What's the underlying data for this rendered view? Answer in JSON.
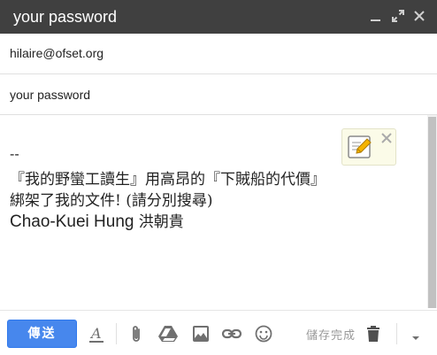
{
  "window": {
    "title": "your password",
    "minimize_icon": "minimize-icon",
    "expand_icon": "expand-icon",
    "close_icon": "close-icon"
  },
  "compose": {
    "recipient": "hilaire@ofset.org",
    "subject": "your password",
    "body": {
      "signature_separator": "--",
      "line1": "『我的野蠻工讀生』用高昂的『下賊船的代價』",
      "line2": "綁架了我的文件! (請分別搜尋)",
      "name_latin": "Chao-Kuei Hung",
      "name_cjk": "洪朝貴"
    }
  },
  "edit_popup": {
    "icon": "pencil-edit-icon",
    "close_icon": "close-icon"
  },
  "toolbar": {
    "send_label": "傳送",
    "save_status": "儲存完成",
    "icons": [
      "text-format-icon",
      "attach-icon",
      "drive-icon",
      "photo-icon",
      "link-icon",
      "emoji-icon",
      "trash-icon",
      "more-options-icon"
    ]
  },
  "colors": {
    "titlebar_bg": "#404040",
    "send_button_bg": "#4787ed",
    "icon_gray": "#707070"
  }
}
